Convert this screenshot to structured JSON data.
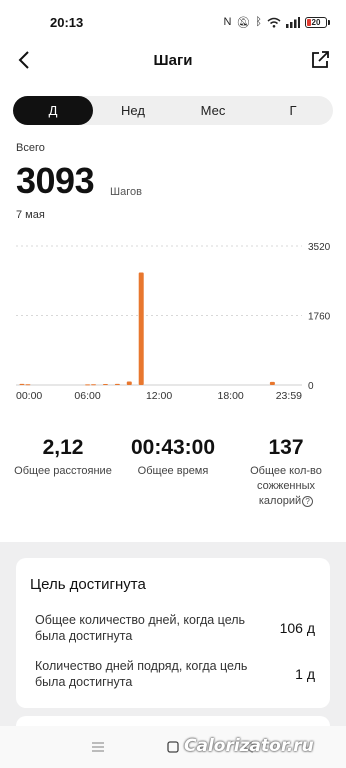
{
  "status": {
    "time": "20:13",
    "battery": "20"
  },
  "header": {
    "title": "Шаги"
  },
  "period_tabs": [
    "Д",
    "Нед",
    "Мес",
    "Г"
  ],
  "active_tab": 0,
  "summary": {
    "label": "Всего",
    "value": "3093",
    "unit": "Шагов",
    "date": "7 мая"
  },
  "colors": {
    "accent": "#e8772e",
    "active_tab_bg": "#111111"
  },
  "chart_data": {
    "type": "bar",
    "x_tick_labels": [
      "00:00",
      "06:00",
      "12:00",
      "18:00",
      "23:59"
    ],
    "y_tick_labels": [
      "3520",
      "1760",
      "0"
    ],
    "ylim": [
      0,
      3520
    ],
    "x": [
      "00:30",
      "01:00",
      "06:00",
      "06:30",
      "07:30",
      "08:30",
      "09:30",
      "10:30",
      "21:30"
    ],
    "values": [
      30,
      20,
      15,
      20,
      25,
      30,
      90,
      2850,
      80
    ]
  },
  "stats": [
    {
      "value": "2,12",
      "label": "Общее расстояние"
    },
    {
      "value": "00:43:00",
      "label": "Общее время"
    },
    {
      "value": "137",
      "label": "Общее кол-во сожженных калорий"
    }
  ],
  "goal": {
    "title": "Цель достигнута",
    "rows": [
      {
        "label": "Общее количество дней, когда цель была достигнута",
        "value": "106 д"
      },
      {
        "label": "Количество дней подряд, когда цель была достигнута",
        "value": "1 д"
      }
    ]
  },
  "watermark": "Calorizator.ru"
}
